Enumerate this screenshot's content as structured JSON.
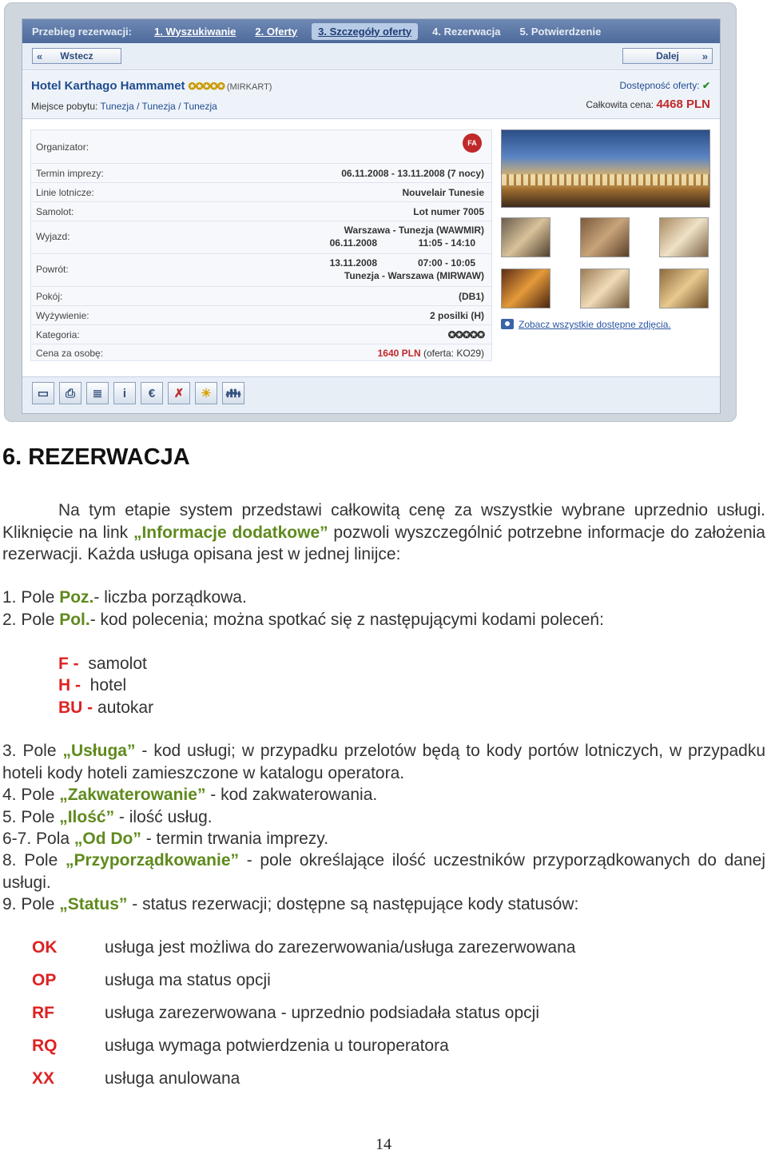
{
  "booking_ui": {
    "steps": {
      "title": "Przebieg rezerwacji:",
      "s1": "1. Wyszukiwanie",
      "s2": "2. Oferty",
      "s3": "3. Szczegóły oferty",
      "s4": "4. Rezerwacja",
      "s5": "5. Potwierdzenie"
    },
    "nav": {
      "back": "Wstecz",
      "next": "Dalej"
    },
    "hotel": {
      "name": "Hotel Karthago Hammamet",
      "stars": "✪✪✪✪✪",
      "code": "(MIRKART)",
      "location_label": "Miejsce pobytu:",
      "location": "Tunezja / Tunezja / Tunezja",
      "availability_label": "Dostępność oferty:",
      "availability_icon": "check-icon",
      "price_label": "Całkowita cena:",
      "price": "4468 PLN"
    },
    "details": {
      "organizer": "Organizator:",
      "organizer_logo": "operator-logo-icon",
      "term_label": "Termin imprezy:",
      "term": "06.11.2008 - 13.11.2008 (7 nocy)",
      "airline_label": "Linie lotnicze:",
      "airline": "Nouvelair Tunesie",
      "plane_label": "Samolot:",
      "plane": "Lot numer 7005",
      "departure_label": "Wyjazd:",
      "dep_route": "Warszawa - Tunezja (WAWMIR)",
      "dep_date": "06.11.2008",
      "dep_time": "11:05 - 14:10",
      "return_label": "Powrót:",
      "ret_date": "13.11.2008",
      "ret_time": "07:00 - 10:05",
      "ret_route": "Tunezja - Warszawa (MIRWAW)",
      "room_label": "Pokój:",
      "room": "(DB1)",
      "board_label": "Wyżywienie:",
      "board": "2 posilki (H)",
      "category_label": "Kategoria:",
      "category": "✪✪✪✪✪",
      "person_price_label": "Cena za osobę:",
      "person_price": "1640 PLN",
      "person_price_offer": "(oferta: KO29)"
    },
    "photos_link": "Zobacz wszystkie dostępne zdjęcia."
  },
  "doc": {
    "heading": "6. REZERWACJA",
    "p1_a": "Na tym etapie system przedstawi całkowitą cenę za wszystkie wybrane uprzednio usługi. Kliknięcie na link ",
    "p1_b": "„Informacje dodatkowe”",
    "p1_c": " pozwoli wyszczególnić potrzebne informacje do założenia rezerwacji. Każda usługa opisana jest w jednej linijce:",
    "l1_a": "1. Pole ",
    "l1_b": "Poz.",
    "l1_c": "- liczba porządkowa.",
    "l2_a": "2. Pole ",
    "l2_b": "Pol.",
    "l2_c": "- kod polecenia; można spotkać się z następującymi kodami poleceń:",
    "codes": [
      {
        "k": "F -",
        "v": "samolot"
      },
      {
        "k": "H -",
        "v": "hotel"
      },
      {
        "k": "BU -",
        "v": "autokar"
      }
    ],
    "l3_a": "3. Pole ",
    "l3_b": "„Usługa”",
    "l3_c": " - kod usługi; w przypadku przelotów będą to kody portów lotniczych, w przypadku hoteli kody hoteli zamieszczone w katalogu operatora.",
    "l4_a": "4. Pole ",
    "l4_b": "„Zakwaterowanie”",
    "l4_c": " -  kod zakwaterowania.",
    "l5_a": "5. Pole ",
    "l5_b": "„Ilość”",
    "l5_c": " - ilość usług.",
    "l6_a": "6-7. Pola ",
    "l6_b": "„Od Do”",
    "l6_c": " - termin trwania imprezy.",
    "l8_a": "8. Pole ",
    "l8_b": "„Przyporządkowanie”",
    "l8_c": " - pole określające ilość uczestników przyporządkowanych do danej usługi.",
    "l9_a": "9. Pole ",
    "l9_b": "„Status”",
    "l9_c": " - status rezerwacji; dostępne są następujące kody statusów:",
    "statuses": [
      {
        "code": "OK",
        "desc": "usługa jest możliwa do zarezerwowania/usługa zarezerwowana"
      },
      {
        "code": "OP",
        "desc": "usługa ma status opcji"
      },
      {
        "code": "RF",
        "desc": "usługa zarezerwowana - uprzednio podsiadała status opcji"
      },
      {
        "code": "RQ",
        "desc": "usługa wymaga potwierdzenia u touroperatora"
      },
      {
        "code": "XX",
        "desc": "usługa anulowana"
      }
    ],
    "page_number": "14"
  }
}
